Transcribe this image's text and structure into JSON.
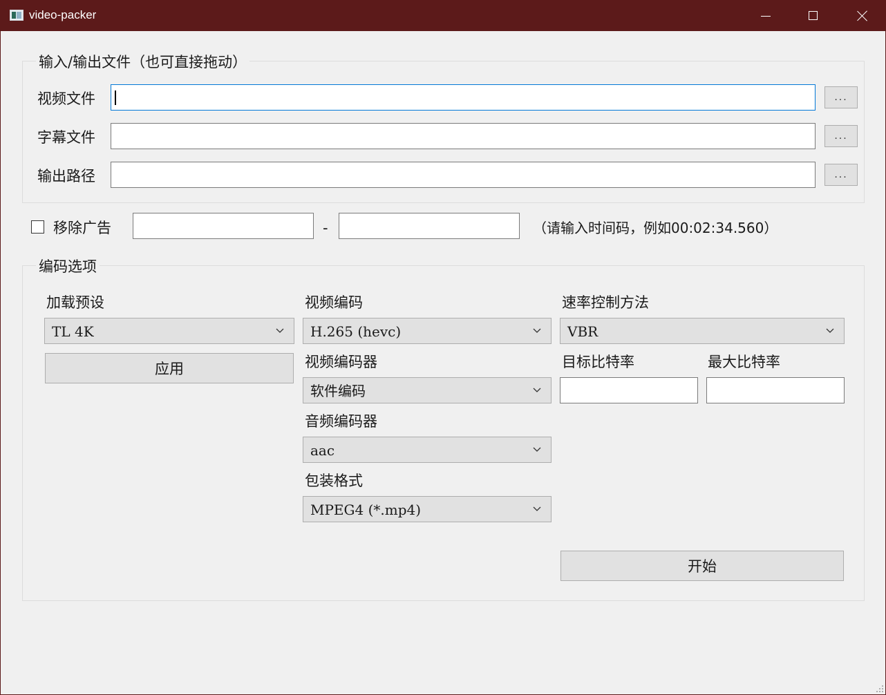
{
  "window": {
    "title": "video-packer"
  },
  "io_group": {
    "title": "输入/输出文件（也可直接拖动）",
    "video_file_label": "视频文件",
    "subtitle_file_label": "字幕文件",
    "output_path_label": "输出路径",
    "video_file_value": "",
    "subtitle_file_value": "",
    "output_path_value": "",
    "browse_label": "..."
  },
  "ad_removal": {
    "checkbox_label": "移除广告",
    "checked": false,
    "start_value": "",
    "end_value": "",
    "separator": "-",
    "hint": "（请输入时间码，例如00:02:34.560）"
  },
  "encode_group": {
    "title": "编码选项",
    "preset_label": "加载预设",
    "preset_value": "TL 4K",
    "apply_label": "应用",
    "video_codec_label": "视频编码",
    "video_codec_value": "H.265 (hevc)",
    "video_encoder_label": "视频编码器",
    "video_encoder_value": "软件编码",
    "audio_encoder_label": "音频编码器",
    "audio_encoder_value": "aac",
    "container_label": "包装格式",
    "container_value": "MPEG4 (*.mp4)",
    "rate_control_label": "速率控制方法",
    "rate_control_value": "VBR",
    "target_bitrate_label": "目标比特率",
    "max_bitrate_label": "最大比特率",
    "target_bitrate_value": "",
    "max_bitrate_value": "",
    "start_label": "开始"
  }
}
